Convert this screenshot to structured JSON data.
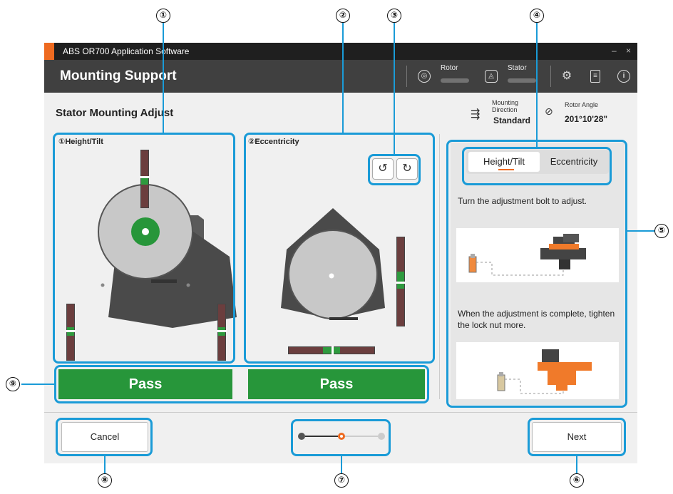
{
  "app": {
    "window_title": "ABS OR700 Application Software",
    "min_btn": "–",
    "close_btn": "×"
  },
  "header": {
    "title": "Mounting Support",
    "rotor_label": "Rotor",
    "stator_label": "Stator",
    "icons": [
      "rotor-icon",
      "stator-icon",
      "settings-icon",
      "manual-icon",
      "info-icon"
    ]
  },
  "page": {
    "title": "Stator Mounting Adjust",
    "mounting_direction_label": "Mounting Direction",
    "mounting_direction_value": "Standard",
    "rotor_angle_label": "Rotor Angle",
    "rotor_angle_value": "201°10'28\""
  },
  "panels": {
    "height_tilt_title": "①Height/Tilt",
    "eccentricity_title": "②Eccentricity"
  },
  "gauges": {
    "top_fill_fraction": 0.5,
    "left_fill_fraction": 0.5,
    "right_fill_fraction": 0.5,
    "ecc_vertical_fill_fraction": 0.5,
    "ecc_horizontal_fill_fraction": 0.5
  },
  "status": {
    "height_tilt_result": "Pass",
    "eccentricity_result": "Pass"
  },
  "guide": {
    "tab_height_tilt": "Height/Tilt",
    "tab_eccentricity": "Eccentricity",
    "instruction_1": "Turn the adjustment bolt to adjust.",
    "instruction_2": "When the adjustment is complete, tighten the lock nut more."
  },
  "footer": {
    "cancel_label": "Cancel",
    "next_label": "Next",
    "steps_total": 3,
    "current_step": 2
  },
  "callouts": [
    "①",
    "②",
    "③",
    "④",
    "⑤",
    "⑥",
    "⑦",
    "⑧",
    "⑨"
  ],
  "colors": {
    "accent": "#ee6a20",
    "pass_green": "#27963a",
    "highlight_blue": "#1a9bd7",
    "header_bg": "#404040"
  }
}
